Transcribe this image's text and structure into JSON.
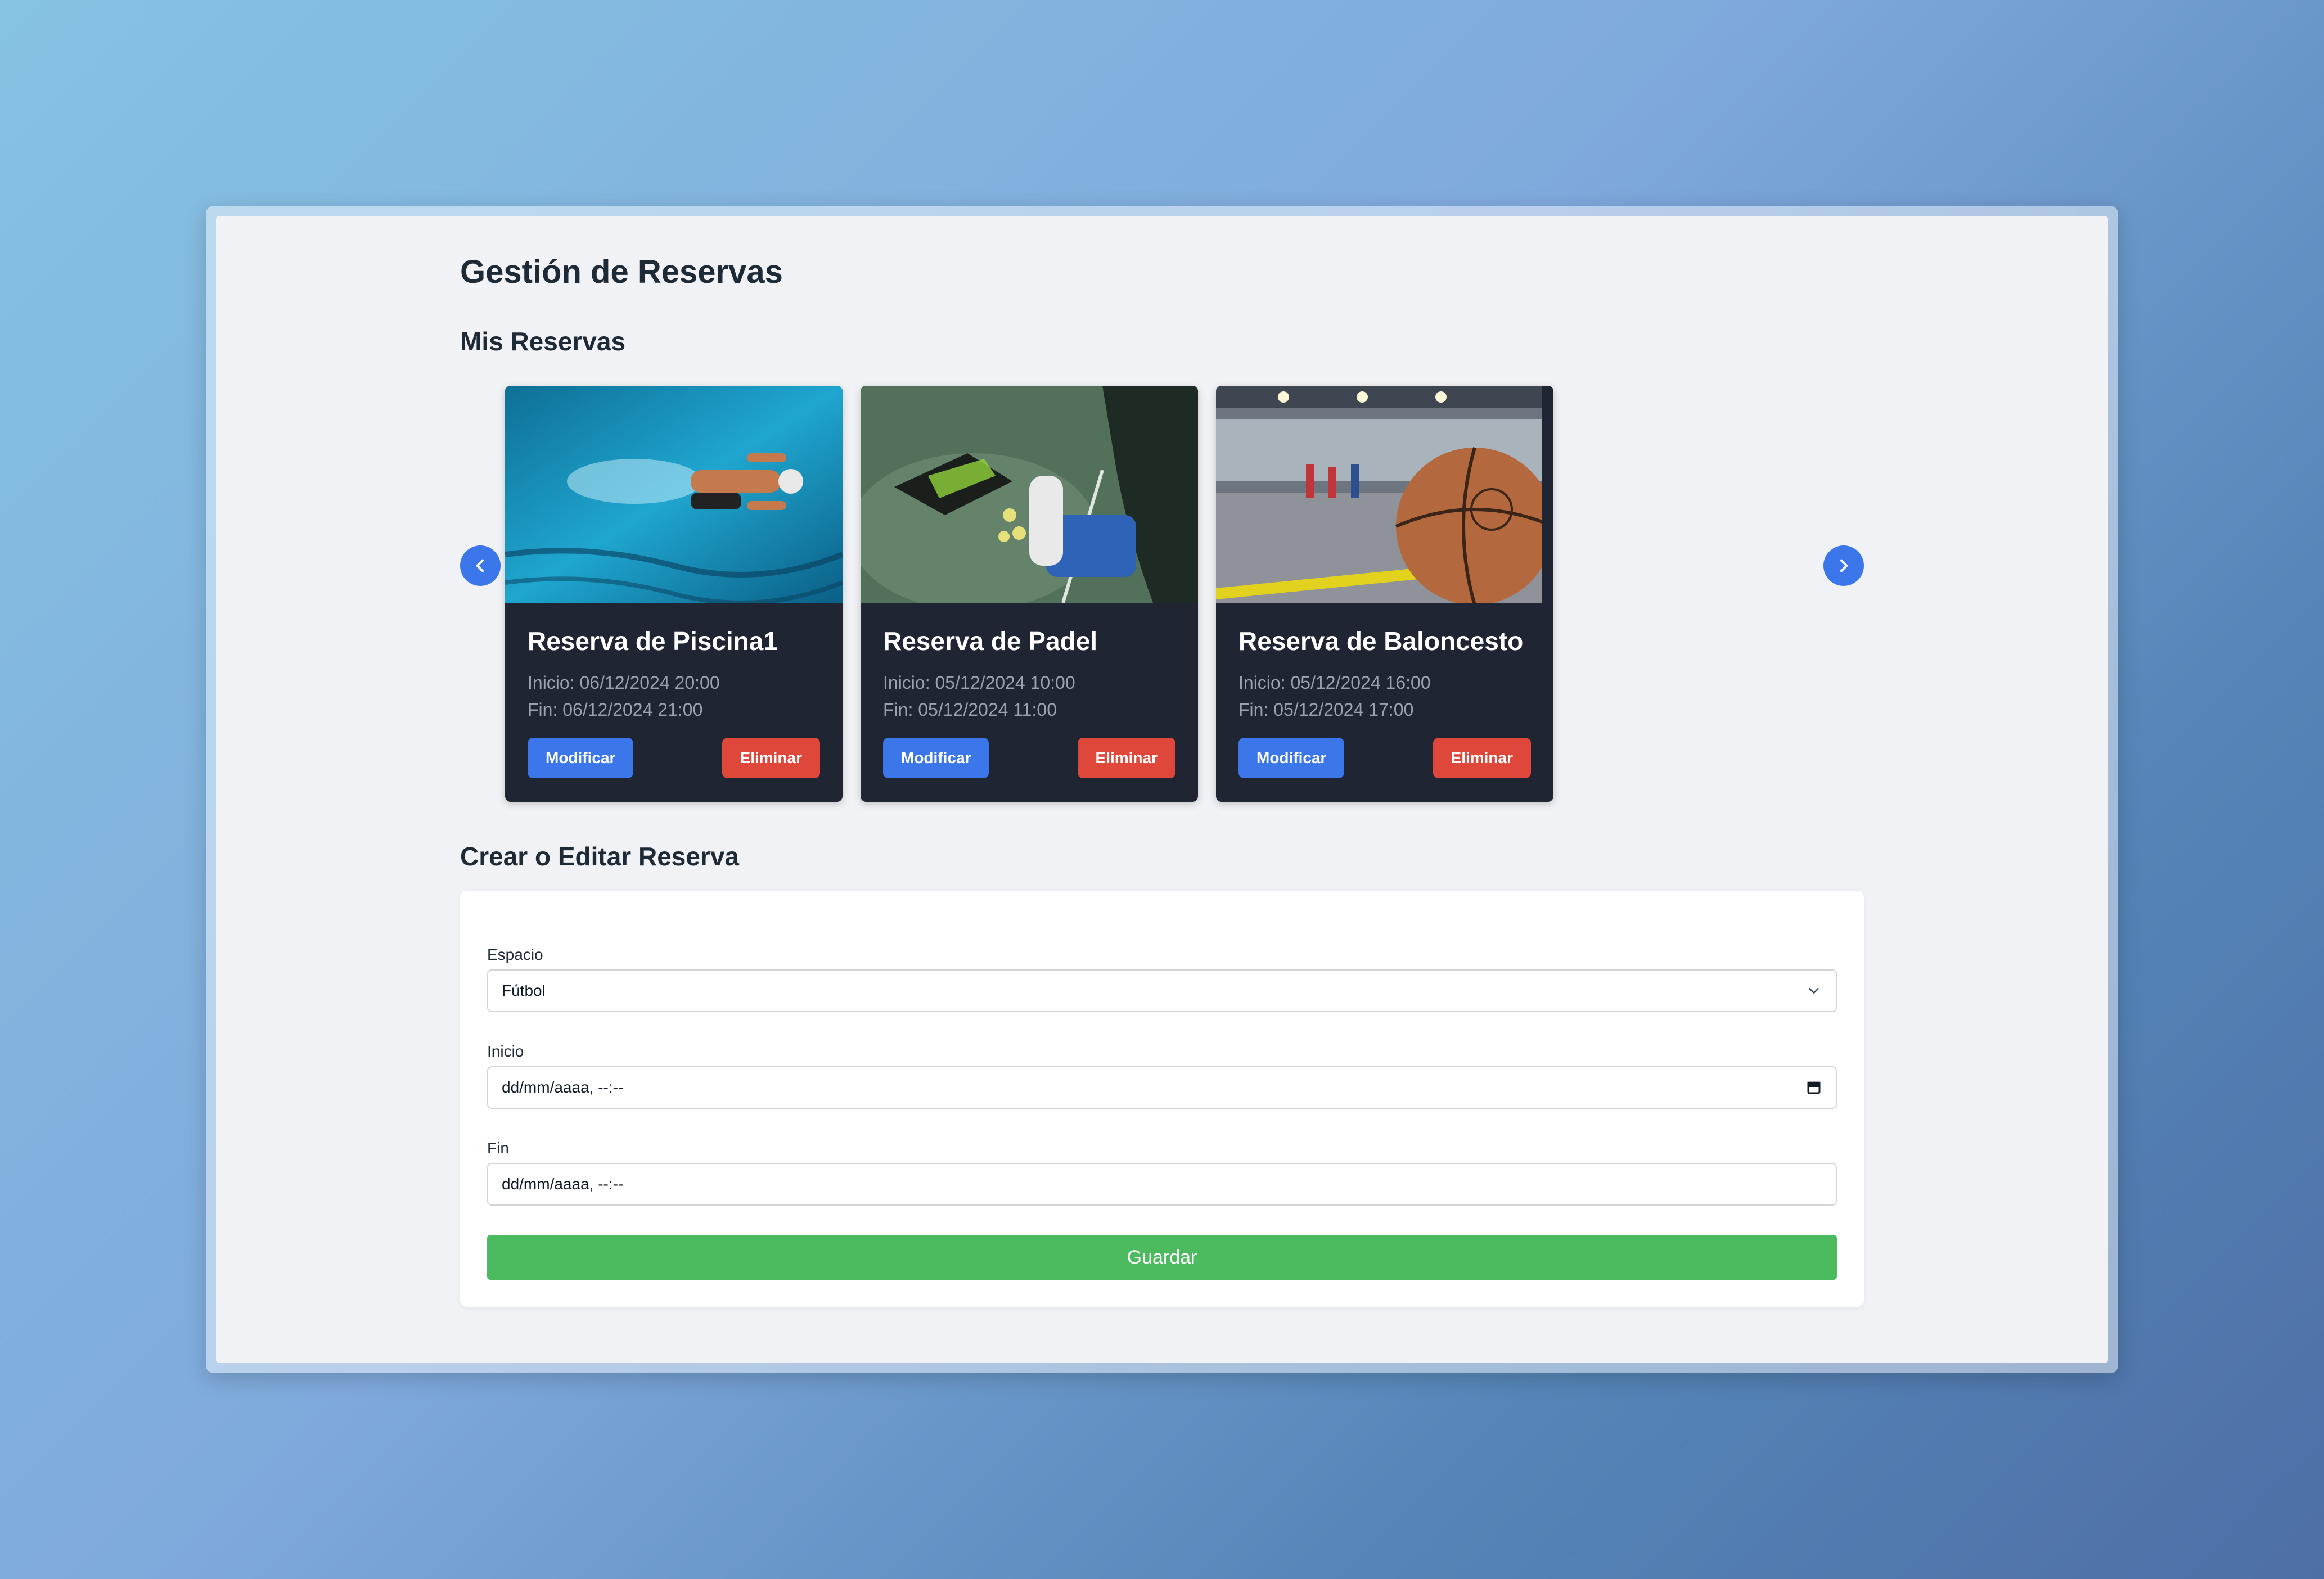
{
  "page": {
    "title": "Gestión de Reservas",
    "my_bookings_heading": "Mis Reservas",
    "form_heading": "Crear o Editar Reserva"
  },
  "carousel": {
    "prev_icon": "chevron-left-icon",
    "next_icon": "chevron-right-icon",
    "cards": [
      {
        "title": "Reserva de Piscina1",
        "start": "Inicio: 06/12/2024 20:00",
        "end": "Fin: 06/12/2024 21:00",
        "image": "swimming-pool-photo",
        "modify_label": "Modificar",
        "delete_label": "Eliminar"
      },
      {
        "title": "Reserva de Padel",
        "start": "Inicio: 05/12/2024 10:00",
        "end": "Fin: 05/12/2024 11:00",
        "image": "padel-court-photo",
        "modify_label": "Modificar",
        "delete_label": "Eliminar"
      },
      {
        "title": "Reserva de Baloncesto",
        "start": "Inicio: 05/12/2024 16:00",
        "end": "Fin: 05/12/2024 17:00",
        "image": "basketball-court-photo",
        "modify_label": "Modificar",
        "delete_label": "Eliminar"
      }
    ]
  },
  "form": {
    "space_label": "Espacio",
    "space_value": "Fútbol",
    "start_label": "Inicio",
    "start_value": "dd/mm/aaaa, --:--",
    "end_label": "Fin",
    "end_value": "dd/mm/aaaa, --:--",
    "save_label": "Guardar"
  },
  "colors": {
    "primary": "#3b76ea",
    "danger": "#e0473b",
    "success": "#4cbb5f",
    "card_bg": "#1f2532"
  }
}
